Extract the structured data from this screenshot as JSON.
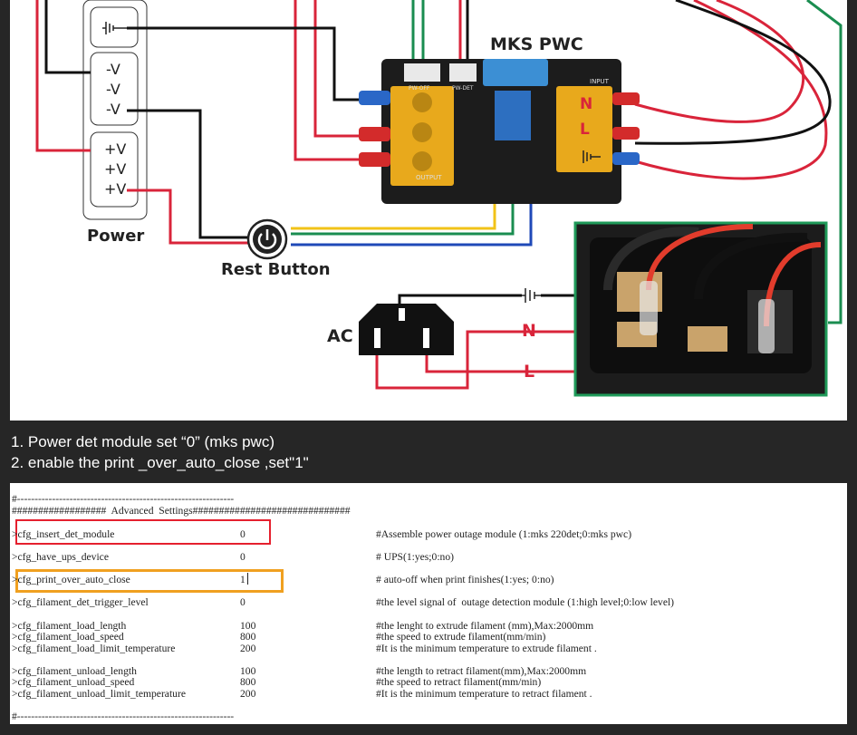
{
  "diagram": {
    "board_title": "MKS PWC",
    "power_label": "Power",
    "rest_button_label": "Rest Button",
    "ac_label": "AC",
    "n_label": "N",
    "l_label": "L",
    "psu_terminals": [
      "-V",
      "-V",
      "-V",
      "+V",
      "+V",
      "+V"
    ],
    "board_text": {
      "input": "INPUT",
      "output": "OUTPUT",
      "pw_off": "PW-OFF",
      "pw_det": "PW-DET",
      "n": "N",
      "l": "L"
    },
    "colors": {
      "red_wire": "#d9243a",
      "black_wire": "#111111",
      "green_wire": "#1a8d50",
      "yellow_wire": "#f2c318",
      "blue_wire": "#1f49b8",
      "board": "#1c1c1c",
      "terminal": "#e8a91c",
      "frame_green": "#1f9a59"
    }
  },
  "instructions": [
    "1. Power det module set “0” (mks pwc)",
    "2. enable the print _over_auto_close ,set\"1\""
  ],
  "config": {
    "rule_line": "#--------------------------------------------------------------",
    "header_line": "##################  Advanced  Settings##############################",
    "rows": [
      {
        "key": ">cfg_insert_det_module",
        "value": "0",
        "comment": "#Assemble power outage module (1:mks 220det;0:mks pwc)"
      },
      {
        "key": ">cfg_have_ups_device",
        "value": "0",
        "comment": "# UPS(1:yes;0:no)"
      },
      {
        "key": ">cfg_print_over_auto_close",
        "value": "1",
        "comment": "# auto-off when print finishes(1:yes; 0:no)"
      },
      {
        "key": ">cfg_filament_det_trigger_level",
        "value": "0",
        "comment": "#the level signal of  outage detection module (1:high level;0:low level)"
      },
      {
        "key": ">cfg_filament_load_length",
        "value": "100",
        "comment": "#the lenght to extrude filament (mm),Max:2000mm"
      },
      {
        "key": ">cfg_filament_load_speed",
        "value": "800",
        "comment": "#the speed to extrude filament(mm/min)"
      },
      {
        "key": ">cfg_filament_load_limit_temperature",
        "value": "200",
        "comment": "#It is the minimum temperature to extrude filament ."
      },
      {
        "key": ">cfg_filament_unload_length",
        "value": "100",
        "comment": "#the length to retract filament(mm),Max:2000mm"
      },
      {
        "key": ">cfg_filament_unload_speed",
        "value": "800",
        "comment": "#the speed to retract filament(mm/min)"
      },
      {
        "key": ">cfg_filament_unload_limit_temperature",
        "value": "200",
        "comment": "#It is the minimum temperature to retract filament ."
      }
    ],
    "footer_line": "#--------------------------------------------------------------",
    "highlight_colors": [
      "#e5202e",
      "#f0a020"
    ]
  }
}
